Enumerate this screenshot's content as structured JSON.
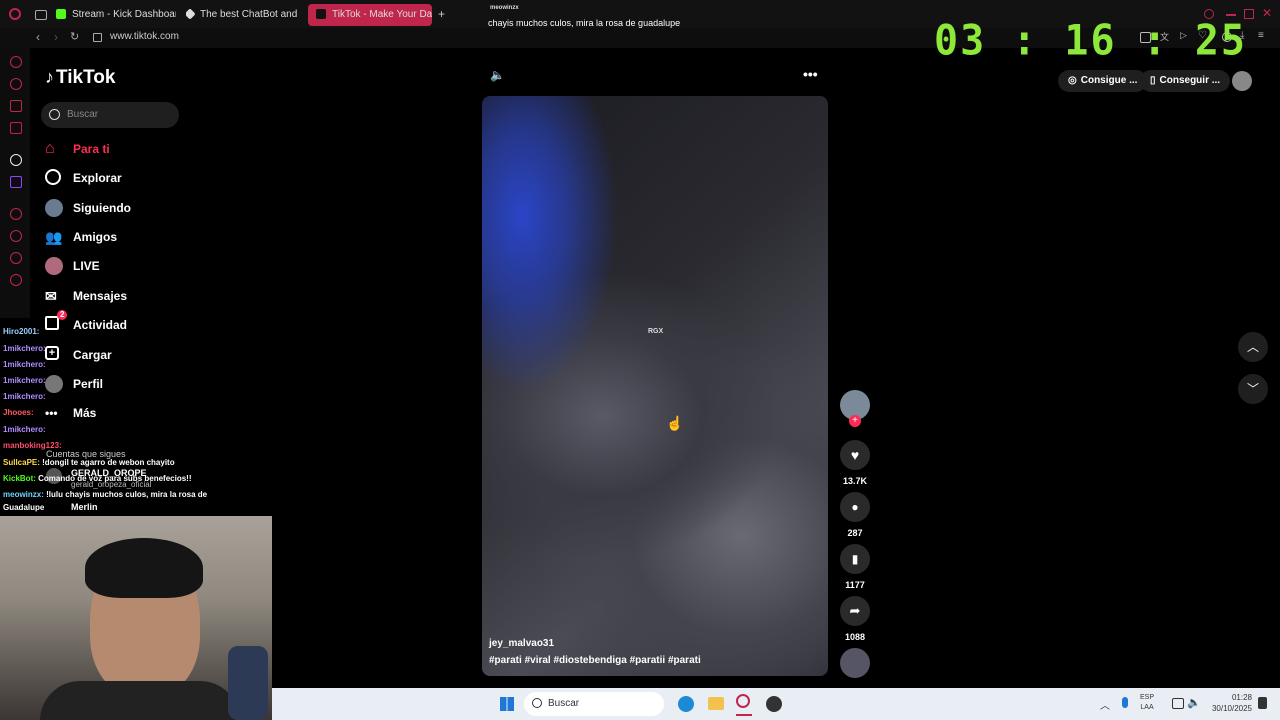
{
  "browser": {
    "tabs": [
      {
        "label": "Stream - Kick Dashboard"
      },
      {
        "label": "The best ChatBot and W"
      },
      {
        "label": "TikTok - Make Your Day"
      }
    ],
    "url": "www.tiktok.com",
    "new_tab": "+"
  },
  "overlay": {
    "chat_user": "meowinzx",
    "chat_message": "chayis muchos culos, mira la rosa de guadalupe",
    "timer": "03 : 16 : 25"
  },
  "tiktok": {
    "logo": "TikTok",
    "search_placeholder": "Buscar",
    "nav": [
      {
        "label": "Para ti",
        "active": true
      },
      {
        "label": "Explorar"
      },
      {
        "label": "Siguiendo"
      },
      {
        "label": "Amigos"
      },
      {
        "label": "LIVE"
      },
      {
        "label": "Mensajes"
      },
      {
        "label": "Actividad",
        "badge": "2"
      },
      {
        "label": "Cargar"
      },
      {
        "label": "Perfil"
      },
      {
        "label": "Más"
      }
    ],
    "following_header": "Cuentas que sigues",
    "following": [
      {
        "name": "GERALD_OROPE",
        "handle": "gerald_oropeza_oficial"
      },
      {
        "name": "Merlin"
      }
    ],
    "top_buttons": [
      "Consigue ...",
      "Conseguir ..."
    ],
    "video": {
      "watermark": "RGX",
      "author": "jey_malvao31",
      "tags": "#parati #viral #diostebendiga #paratii #parati"
    },
    "actions": {
      "likes": "13.7K",
      "comments": "287",
      "saves": "1177",
      "shares": "1088"
    }
  },
  "chat": [
    {
      "user": "Hiro2001:",
      "text": "",
      "color": "#9ad0ff"
    },
    {
      "user": "1mikchero:",
      "text": "",
      "color": "#b38cff"
    },
    {
      "user": "1mikchero:",
      "text": "",
      "color": "#b38cff"
    },
    {
      "user": "1mikchero:",
      "text": "",
      "color": "#b38cff"
    },
    {
      "user": "1mikchero:",
      "text": "",
      "color": "#b38cff"
    },
    {
      "user": "Jhooes:",
      "text": "",
      "color": "#ff5a5a"
    },
    {
      "user": "1mikchero:",
      "text": "",
      "color": "#b38cff"
    },
    {
      "user": "manboking123:",
      "text": "",
      "color": "#ff4d6d"
    },
    {
      "user": "SullcaPE:",
      "text": "!dongil te agarro de webon chayito",
      "color": "#ffd84d"
    },
    {
      "user": "KickBot:",
      "text": "Comando de voz para subs benefecios!!",
      "color": "#53fc18"
    },
    {
      "user": "meowinzx:",
      "text": "!lulu chayis muchos culos, mira la rosa de",
      "color": "#6fd3ff"
    },
    {
      "user": "",
      "text": "Guadalupe",
      "color": "#ffffff"
    }
  ],
  "taskbar": {
    "search": "Buscar",
    "lang_top": "ESP",
    "lang_bottom": "LAA",
    "time": "01:28",
    "date": "30/10/2025"
  },
  "colors": {
    "accent": "#fe2c55",
    "timer": "#8ee83a",
    "opera": "#c0264b"
  }
}
